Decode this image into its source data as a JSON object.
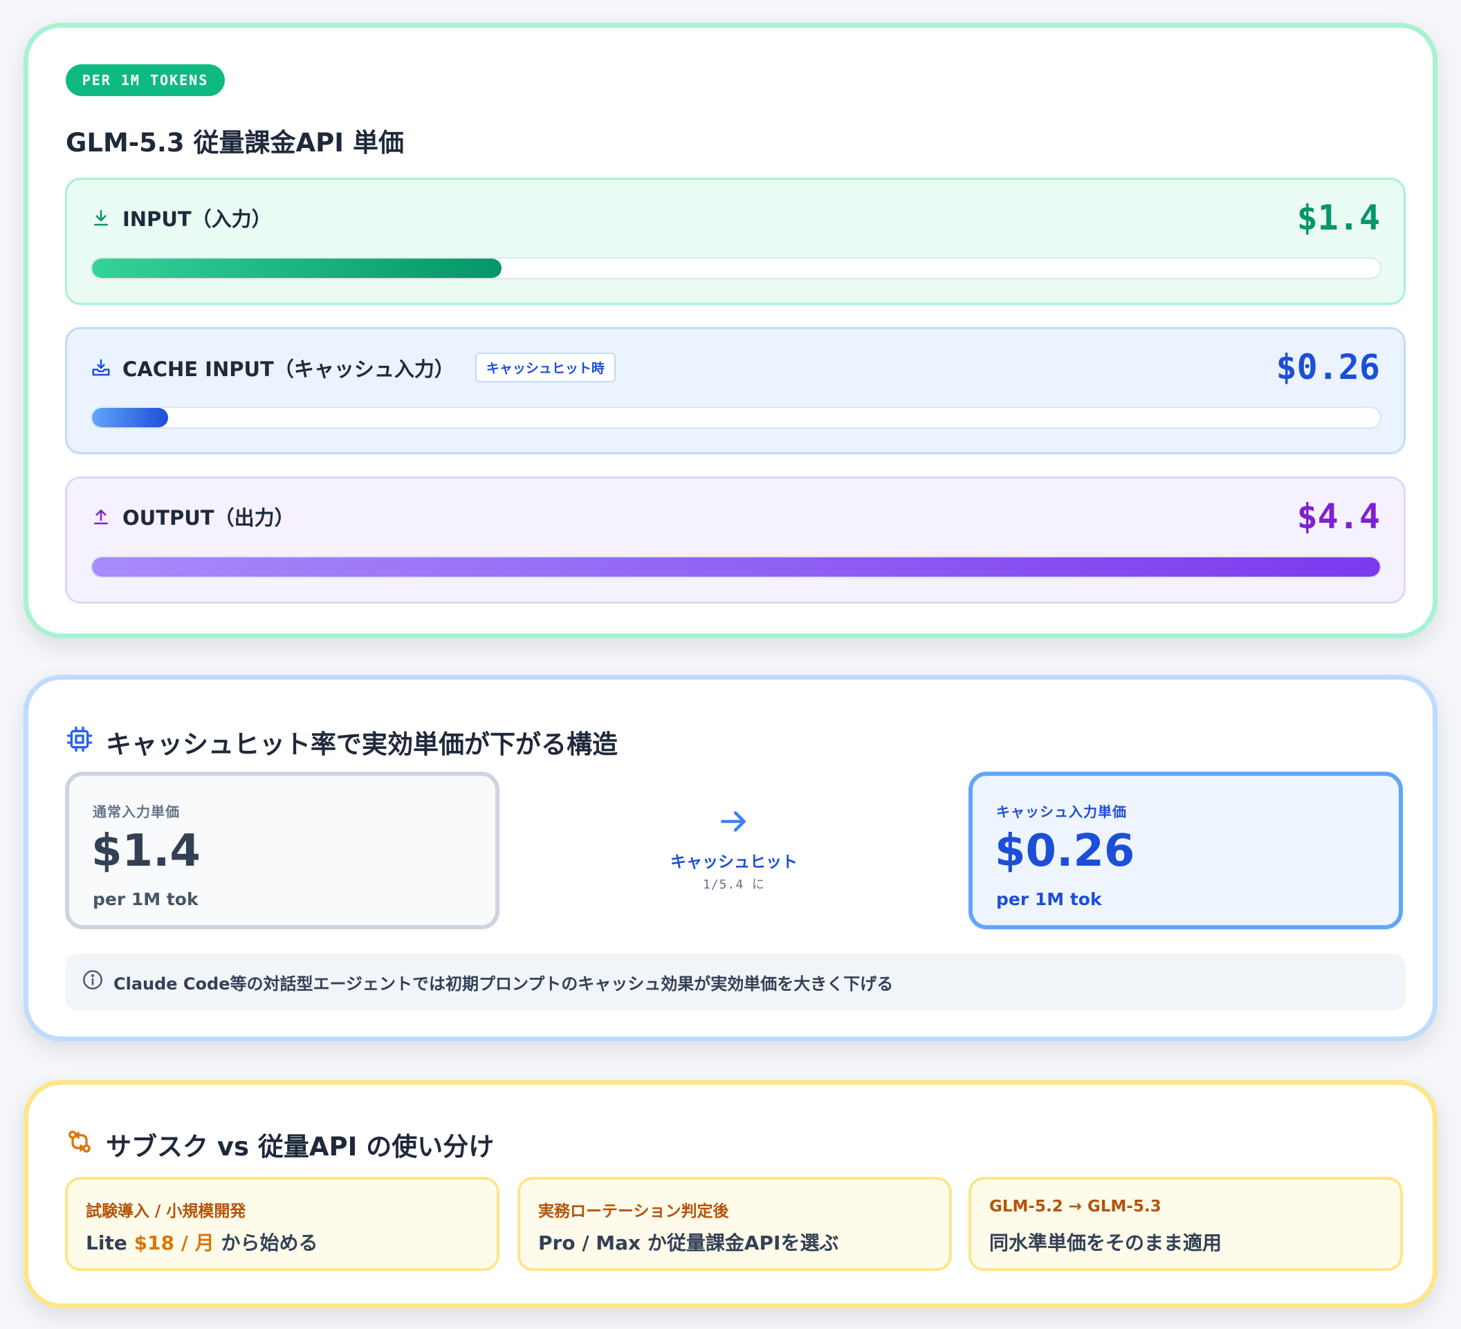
{
  "colors": {
    "input": "#059669",
    "cache": "#1d4ed8",
    "output": "#7e22ce",
    "badge": "#10b981",
    "usage_accent": "#d97706"
  },
  "pricing": {
    "badge": "PER 1M TOKENS",
    "title": "GLM-5.3 従量課金API 単価",
    "rows": [
      {
        "label": "INPUT（入力）",
        "icon": "download-arrow-icon",
        "value": "$1.4",
        "fill_fraction": 0.318
      },
      {
        "label": "CACHE INPUT（キャッシュ入力）",
        "icon": "inbox-download-icon",
        "tag": "キャッシュヒット時",
        "value": "$0.26",
        "fill_fraction": 0.059
      },
      {
        "label": "OUTPUT（出力）",
        "icon": "upload-arrow-icon",
        "value": "$4.4",
        "fill_fraction": 1.0
      }
    ]
  },
  "cache": {
    "icon": "chip-icon",
    "title": "キャッシュヒット率で実効単価が下がる構造",
    "normal": {
      "label": "通常入力単価",
      "value": "$1.4",
      "unit": "per 1M tok"
    },
    "cached": {
      "label": "キャッシュ入力単価",
      "value": "$0.26",
      "unit": "per 1M tok"
    },
    "arrow_label": "キャッシュヒット",
    "arrow_sub": "1/5.4 に",
    "note_icon": "info-icon",
    "note": "Claude Code等の対話型エージェントでは初期プロンプトのキャッシュ効果が実効単価を大きく下げる"
  },
  "usage": {
    "icon": "git-compare-icon",
    "title": "サブスク vs 従量API の使い分け",
    "items": [
      {
        "head": "試験導入 / 小規模開発",
        "body_pre": "Lite ",
        "body_accent": "$18 / 月",
        "body_post": " から始める"
      },
      {
        "head": "実務ローテーション判定後",
        "body_pre": "Pro / Max か従量課金APIを選ぶ",
        "body_accent": "",
        "body_post": ""
      },
      {
        "head": "GLM-5.2 → GLM-5.3",
        "body_pre": "同水準単価をそのまま適用",
        "body_accent": "",
        "body_post": ""
      }
    ]
  }
}
